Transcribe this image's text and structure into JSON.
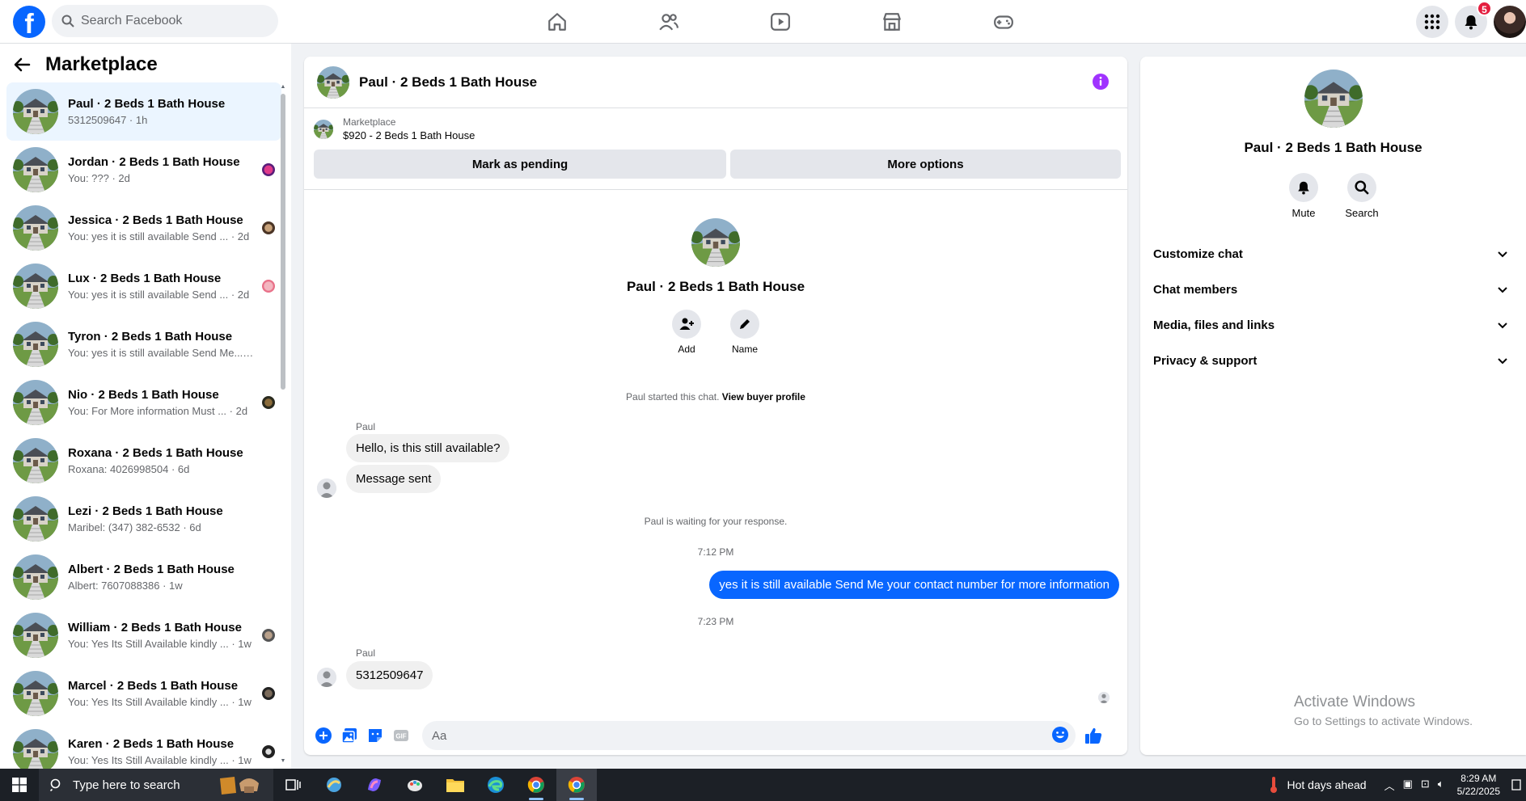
{
  "header": {
    "logo": "f",
    "search_placeholder": "Search Facebook",
    "notifications_count": "5",
    "nav_icons": [
      "home-icon",
      "friends-icon",
      "video-icon",
      "marketplace-icon",
      "gaming-icon"
    ]
  },
  "sidebar": {
    "title": "Marketplace",
    "conversations": [
      {
        "name": "Paul · 2 Beds 1 Bath House",
        "preview": "5312509647 · 1h",
        "active": true
      },
      {
        "name": "Jordan · 2 Beds 1 Bath House",
        "preview": "You: ??? · 2d"
      },
      {
        "name": "Jessica · 2 Beds 1 Bath House",
        "preview": "You: yes it is still available Send ...  · 2d"
      },
      {
        "name": "Lux · 2 Beds 1 Bath House",
        "preview": "You: yes it is still available Send ...  · 2d"
      },
      {
        "name": "Tyron · 2 Beds 1 Bath House",
        "preview": "You: yes it is still available Send Me...  · 2d"
      },
      {
        "name": "Nio · 2 Beds 1 Bath House",
        "preview": "You: For More information Must ...  · 2d"
      },
      {
        "name": "Roxana · 2 Beds 1 Bath House",
        "preview": "Roxana: 4026998504 · 6d"
      },
      {
        "name": "Lezi · 2 Beds 1 Bath House",
        "preview": "Maribel: (347) 382-6532 · 6d"
      },
      {
        "name": "Albert · 2 Beds 1 Bath House",
        "preview": "Albert: 7607088386 · 1w"
      },
      {
        "name": "William · 2 Beds 1 Bath House",
        "preview": "You: Yes Its Still Available kindly ...  · 1w"
      },
      {
        "name": "Marcel · 2 Beds 1 Bath House",
        "preview": "You: Yes Its Still Available kindly ...  · 1w"
      },
      {
        "name": "Karen · 2 Beds 1 Bath House",
        "preview": "You: Yes Its Still Available kindly ...  · 1w"
      }
    ]
  },
  "chat": {
    "title": "Paul · 2 Beds 1 Bath House",
    "listing_source": "Marketplace",
    "listing_title": "$920 - 2 Beds 1 Bath House",
    "mark_pending": "Mark as pending",
    "more_options": "More options",
    "intro_name": "Paul · 2 Beds 1 Bath House",
    "add_label": "Add",
    "name_label": "Name",
    "started_text": "Paul started this chat.",
    "view_buyer": "View buyer profile",
    "sender1": "Paul",
    "msg1": "Hello, is this still available?",
    "msg2": "Message sent",
    "waiting": "Paul is waiting for your response.",
    "time1": "7:12 PM",
    "msg_out": "yes it is still available Send Me your contact number for more information",
    "time2": "7:23 PM",
    "sender2": "Paul",
    "msg3": "5312509647",
    "composer_placeholder": "Aa"
  },
  "right_panel": {
    "name": "Paul · 2 Beds 1 Bath House",
    "mute": "Mute",
    "search": "Search",
    "sections": [
      "Customize chat",
      "Chat members",
      "Media, files and links",
      "Privacy & support"
    ],
    "watermark_title": "Activate Windows",
    "watermark_sub": "Go to Settings to activate Windows."
  },
  "taskbar": {
    "search_text": "Type here to search",
    "weather": "Hot days ahead",
    "time": "8:29 AM",
    "date": "5/22/2025"
  },
  "colors": {
    "brand": "#0866ff",
    "badge": "#e41e3f",
    "info": "#a033ff"
  }
}
